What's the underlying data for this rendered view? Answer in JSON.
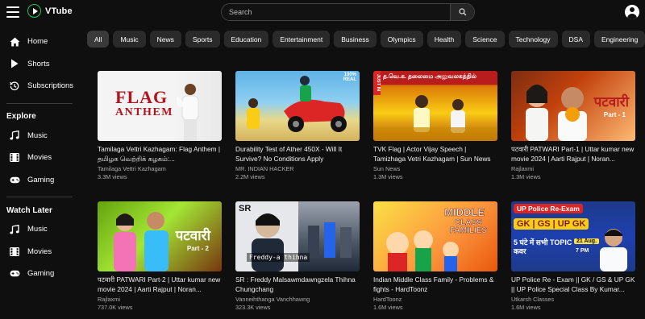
{
  "app": {
    "name": "VTube"
  },
  "search": {
    "placeholder": "Search"
  },
  "sidebar": {
    "main": [
      {
        "label": "Home",
        "icon": "home-icon"
      },
      {
        "label": "Shorts",
        "icon": "play-icon"
      },
      {
        "label": "Subscriptions",
        "icon": "history-icon"
      }
    ],
    "explore_title": "Explore",
    "explore": [
      {
        "label": "Music",
        "icon": "music-icon"
      },
      {
        "label": "Movies",
        "icon": "movies-icon"
      },
      {
        "label": "Gaming",
        "icon": "gaming-icon"
      }
    ],
    "watch_later_title": "Watch Later",
    "watch_later": [
      {
        "label": "Music",
        "icon": "music-icon"
      },
      {
        "label": "Movies",
        "icon": "movies-icon"
      },
      {
        "label": "Gaming",
        "icon": "gaming-icon"
      }
    ]
  },
  "chips": [
    "All",
    "Music",
    "News",
    "Sports",
    "Education",
    "Entertainment",
    "Business",
    "Olympics",
    "Health",
    "Science",
    "Technology",
    "DSA",
    "Engineering"
  ],
  "videos": [
    {
      "title": "Tamilaga Vettri Kazhagam: Flag Anthem | தமிழக வெற்றிக் கழகம்:...",
      "channel": "Tamilaga Vettri Kazhagam",
      "views": "3.3M views",
      "thumb_text_1": "FLAG",
      "thumb_text_2": "ANTHEM"
    },
    {
      "title": "Durability Test of Ather 450X - Will It Survive? No Conditions Apply",
      "channel": "MR. INDIAN HACKER",
      "views": "2.2M views",
      "thumb_text_1": "100% REAL"
    },
    {
      "title": "TVK Flag | Actor Vijay Speech | Tamizhaga Vetri Kazhagam | Sun News",
      "channel": "Sun News",
      "views": "1.3M views",
      "thumb_text_1": "த.வெ.க. தலைமை அலுவலகத்தில்",
      "thumb_text_2": "JUST IN"
    },
    {
      "title": "पटवारी PATWARI Part-1 | Uttar kumar new movie 2024 | Aarti Rajput | Noran...",
      "channel": "Rajlaxmi",
      "views": "1.3M views",
      "thumb_text_1": "पटवारी",
      "thumb_text_2": "Part - 1"
    },
    {
      "title": "पटवारी PATWARI Part-2 | Uttar kumar new movie 2024 | Aarti Rajput | Noran...",
      "channel": "Rajlaxmi",
      "views": "737.0K views",
      "thumb_text_1": "पटवारी",
      "thumb_text_2": "Part - 2"
    },
    {
      "title": "SR : Freddy Malsawmdawngzela Thihna Chungchang",
      "channel": "Vanneihthanga Vanchhawng",
      "views": "323.3K views",
      "thumb_text_1": "SR",
      "thumb_text_2": "Freddy-a thihna"
    },
    {
      "title": "Indian Middle Class Family - Problems & fights - HardToonz",
      "channel": "HardToonz",
      "views": "1.6M views",
      "thumb_text_1": "MIDDLE",
      "thumb_text_2": "CLASS FAMILIES"
    },
    {
      "title": "UP Police Re - Exam || GK / GS & UP GK || UP Police Special Class By Kumar...",
      "channel": "Utkarsh Classes",
      "views": "1.6M views",
      "thumb_text_1": "UP Police Re-Exam",
      "thumb_text_2": "GK | GS | UP GK",
      "thumb_text_3": "5 घंटे में सभी TOPIC कवर",
      "thumb_text_4": "21 Aug.",
      "thumb_text_5": "7 PM"
    }
  ]
}
